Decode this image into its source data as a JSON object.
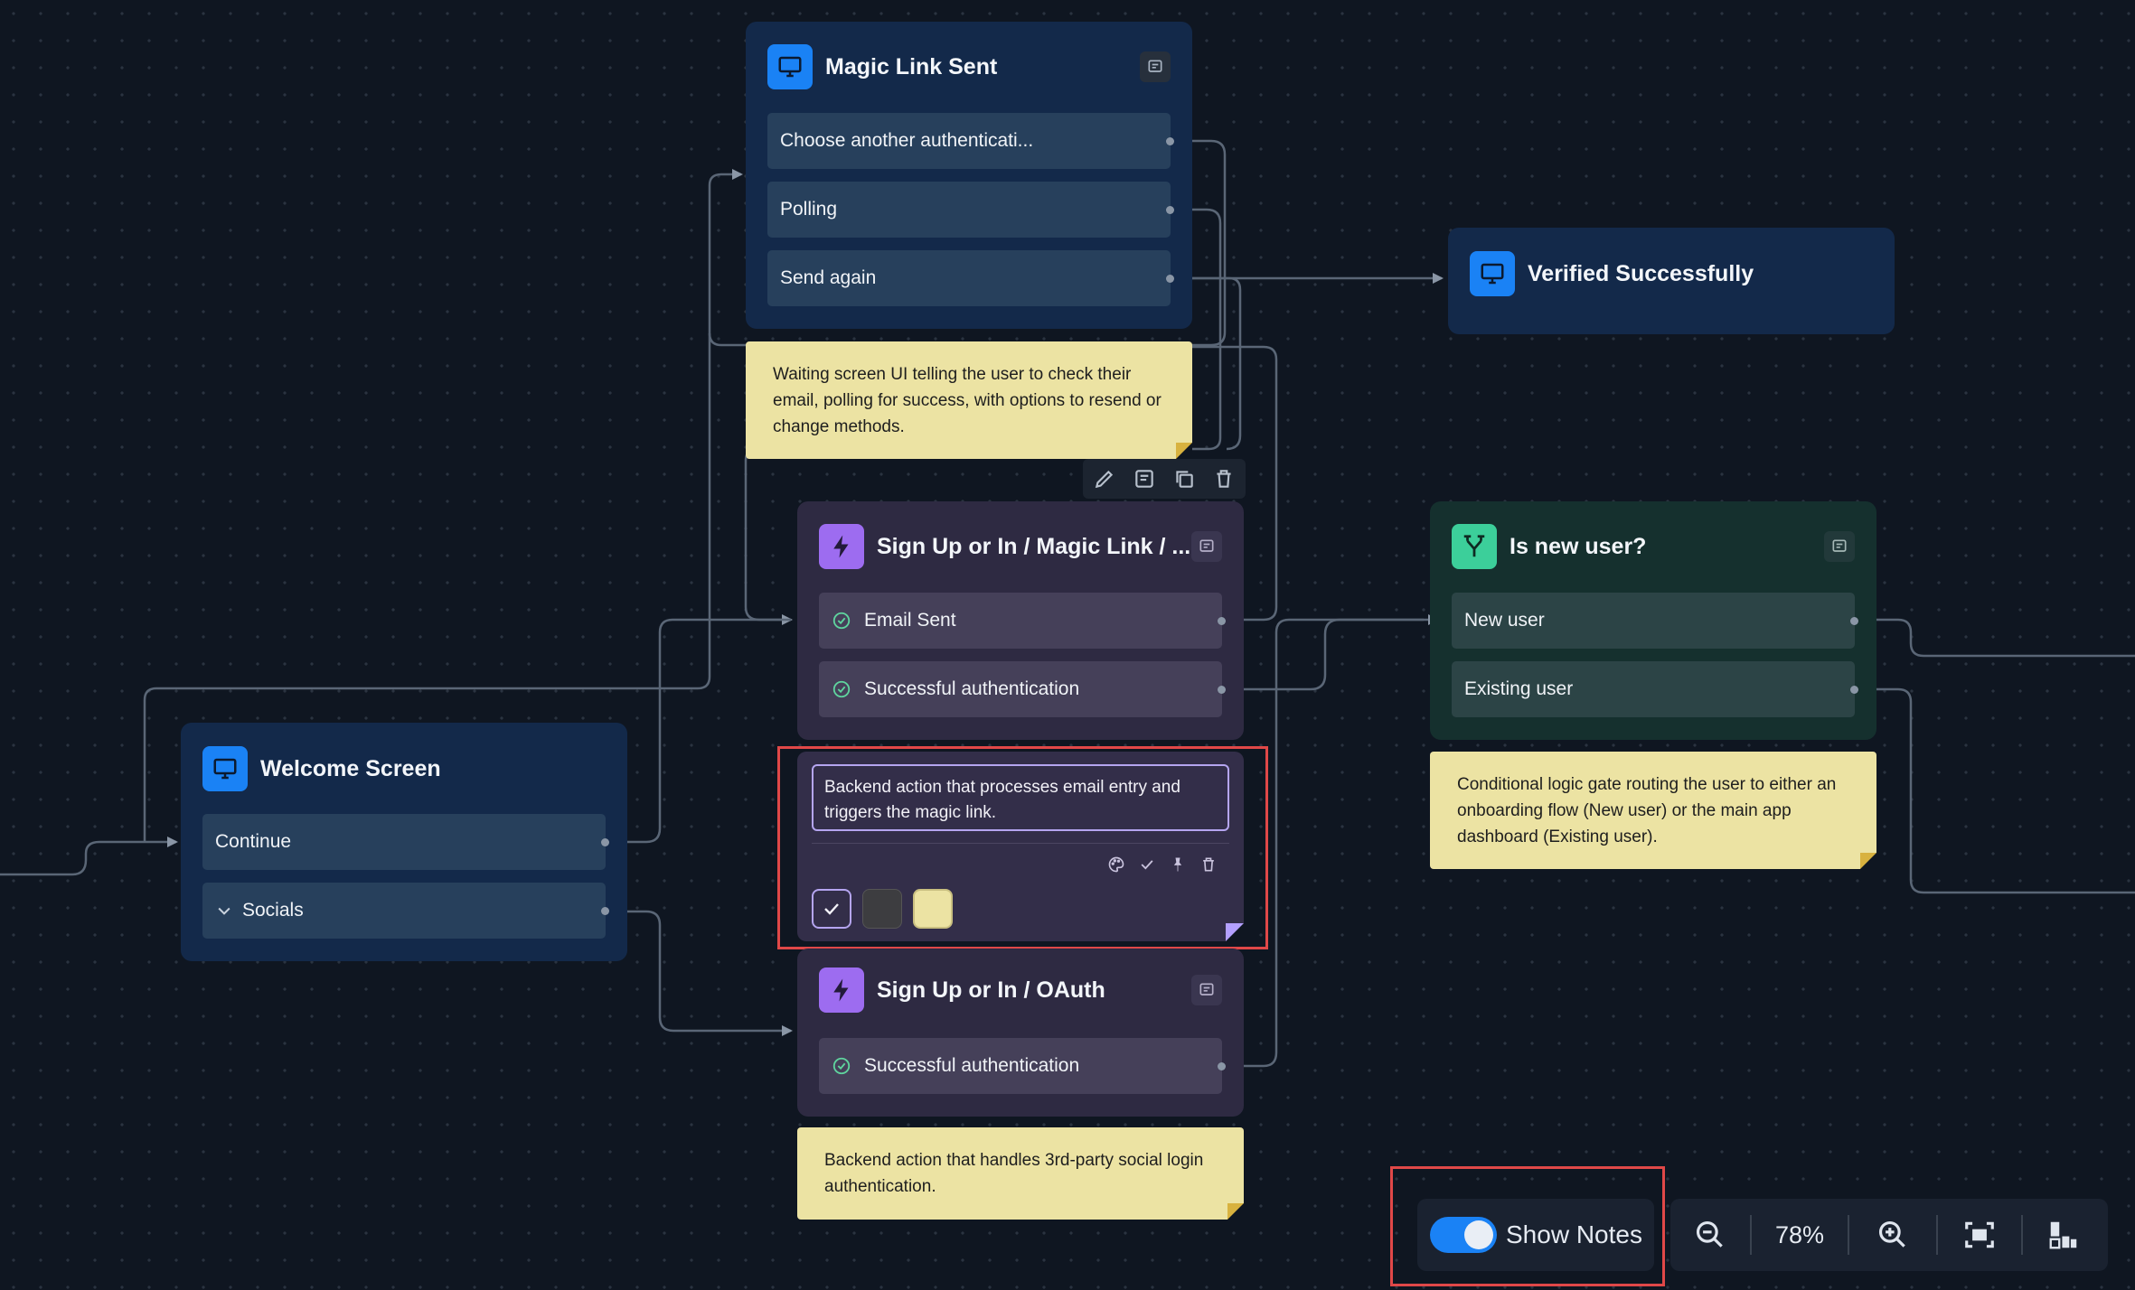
{
  "nodes": {
    "magic_link_sent": {
      "title": "Magic Link Sent",
      "rows": [
        "Choose another authenticati...",
        "Polling",
        "Send again"
      ],
      "note": "Waiting screen UI telling the user to check their email, polling for success, with options to resend or change methods."
    },
    "verified": {
      "title": "Verified Successfully"
    },
    "sign_up_magic": {
      "title": "Sign Up or In / Magic Link / ...",
      "rows": [
        "Email Sent",
        "Successful authentication"
      ],
      "note_editing": "Backend action that processes email entry and triggers the magic link."
    },
    "is_new_user": {
      "title": "Is new user?",
      "rows": [
        "New user",
        "Existing user"
      ],
      "note": "Conditional logic gate routing the user to either an onboarding flow (New user) or the main app dashboard (Existing user)."
    },
    "welcome": {
      "title": "Welcome Screen",
      "rows": [
        "Continue",
        "Socials"
      ]
    },
    "sign_up_oauth": {
      "title": "Sign Up or In / OAuth",
      "rows": [
        "Successful authentication"
      ],
      "note": "Backend action that handles 3rd-party social login authentication."
    }
  },
  "note_colors": [
    "#332e49",
    "#3d3d40",
    "#ece3a3"
  ],
  "controls": {
    "show_notes_label": "Show Notes",
    "show_notes_on": true,
    "zoom": "78%"
  },
  "colors": {
    "canvas": "#0f1621",
    "screen_node": "#13294a",
    "action_node": "#2e2a42",
    "condition_node": "#15302e",
    "accent_blue": "#1a82f5",
    "accent_purple": "#9d6cf0",
    "accent_green": "#3ccf9a",
    "sticky": "#ece3a3",
    "highlight": "#e04848"
  }
}
